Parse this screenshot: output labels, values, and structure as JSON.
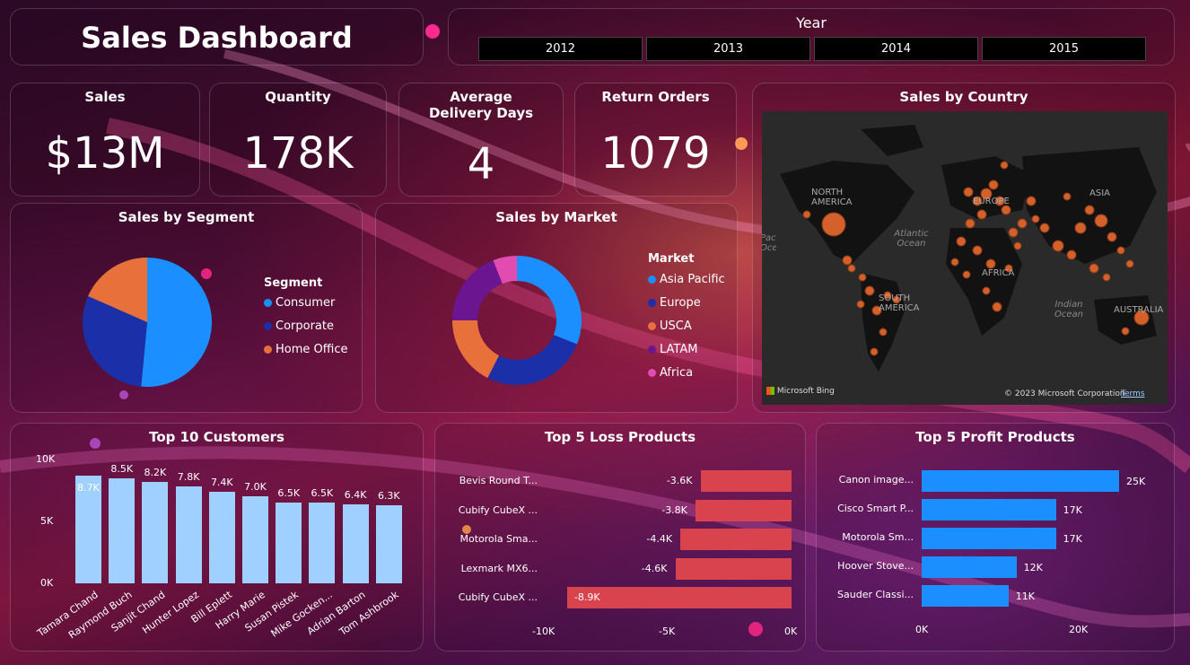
{
  "header": {
    "title": "Sales Dashboard"
  },
  "year_filter": {
    "title": "Year",
    "options": [
      "2012",
      "2013",
      "2014",
      "2015"
    ]
  },
  "kpis": [
    {
      "label": "Sales",
      "value": "$13M"
    },
    {
      "label": "Quantity",
      "value": "178K"
    },
    {
      "label": "Average Delivery Days",
      "value": "4"
    },
    {
      "label": "Return Orders",
      "value": "1079"
    }
  ],
  "segment_chart": {
    "title": "Sales by Segment",
    "legend_title": "Segment",
    "colors": {
      "Consumer": "#1b8fff",
      "Corporate": "#1a2fa8",
      "Home Office": "#e8703a"
    }
  },
  "market_chart": {
    "title": "Sales by Market",
    "legend_title": "Market",
    "colors": {
      "Asia Pacific": "#1b8fff",
      "Europe": "#1a2fa8",
      "USCA": "#e8703a",
      "LATAM": "#6b1690",
      "Africa": "#e04cb0"
    }
  },
  "map": {
    "title": "Sales by Country",
    "labels": {
      "north_america": "NORTH AMERICA",
      "south_america": "SOUTH AMERICA",
      "europe": "EUROPE",
      "africa": "AFRICA",
      "asia": "ASIA",
      "australia": "AUSTRALIA",
      "atlantic": "Atlantic Ocean",
      "indian": "Indian Ocean",
      "pacific": "Pacific Ocean"
    },
    "bing": "Microsoft Bing",
    "copyright": "© 2023 Microsoft Corporation",
    "terms": "Terms"
  },
  "customers_chart": {
    "title": "Top 10 Customers",
    "bar_color": "#9fd0ff",
    "y_ticks": [
      "10K",
      "5K",
      "0K"
    ]
  },
  "loss_chart": {
    "title": "Top 5 Loss Products",
    "bar_color": "#d8434e",
    "x_ticks": [
      "-10K",
      "-5K",
      "0K"
    ]
  },
  "profit_chart": {
    "title": "Top 5 Profit Products",
    "bar_color": "#1b8fff",
    "x_ticks": [
      "0K",
      "20K"
    ]
  },
  "chart_data": [
    {
      "type": "pie",
      "title": "Sales by Segment",
      "categories": [
        "Consumer",
        "Corporate",
        "Home Office"
      ],
      "values": [
        51.5,
        30.1,
        18.4
      ]
    },
    {
      "type": "pie",
      "title": "Sales by Market",
      "categories": [
        "Asia Pacific",
        "Europe",
        "USCA",
        "LATAM",
        "Africa"
      ],
      "values": [
        31.0,
        26.5,
        17.5,
        19.0,
        6.0
      ]
    },
    {
      "type": "bar",
      "title": "Top 10 Customers",
      "categories": [
        "Tamara Chand",
        "Raymond Buch",
        "Sanjit Chand",
        "Hunter Lopez",
        "Bill Eplett",
        "Harry Marie",
        "Susan Pistek",
        "Mike Gocken...",
        "Adrian Barton",
        "Tom Ashbrook"
      ],
      "values": [
        8.7,
        8.5,
        8.2,
        7.8,
        7.4,
        7.0,
        6.5,
        6.5,
        6.4,
        6.3
      ],
      "value_labels": [
        "8.7K",
        "8.5K",
        "8.2K",
        "7.8K",
        "7.4K",
        "7.0K",
        "6.5K",
        "6.5K",
        "6.4K",
        "6.3K"
      ],
      "ylim": [
        0,
        10
      ]
    },
    {
      "type": "bar",
      "title": "Top 5 Loss Products",
      "categories": [
        "Bevis Round T...",
        "Cubify CubeX ...",
        "Motorola Sma...",
        "Lexmark MX6...",
        "Cubify CubeX ..."
      ],
      "values": [
        -3.6,
        -3.8,
        -4.4,
        -4.6,
        -8.9
      ],
      "value_labels": [
        "-3.6K",
        "-3.8K",
        "-4.4K",
        "-4.6K",
        "-8.9K"
      ],
      "xlim": [
        -10,
        0
      ]
    },
    {
      "type": "bar",
      "title": "Top 5 Profit Products",
      "categories": [
        "Canon image...",
        "Cisco Smart P...",
        "Motorola Sm...",
        "Hoover Stove...",
        "Sauder Classi..."
      ],
      "values": [
        25,
        17,
        17,
        12,
        11
      ],
      "value_labels": [
        "25K",
        "17K",
        "17K",
        "12K",
        "11K"
      ],
      "xlim": [
        0,
        25
      ]
    }
  ]
}
